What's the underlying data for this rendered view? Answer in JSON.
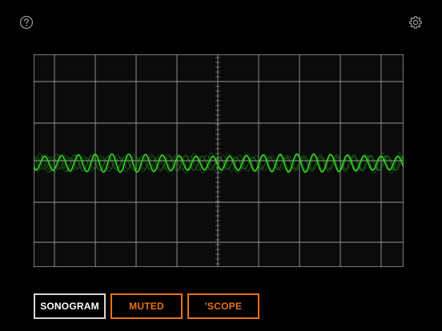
{
  "toolbar": {
    "help_icon": "question-circle-icon",
    "settings_icon": "gear-icon"
  },
  "scope": {
    "trace_color": "#33DD22",
    "grid_color": "#9A9A9A",
    "background": "#0B0B0B",
    "waveform": "sine, multiple overlaid traces"
  },
  "buttons": {
    "sonogram_label": "SONOGRAM",
    "muted_label": "MUTED",
    "scope_label": "'SCOPE"
  },
  "colors": {
    "accent": "#E8701A",
    "selected_border": "#D6D6D6",
    "selected_text": "#FFFFFF"
  }
}
